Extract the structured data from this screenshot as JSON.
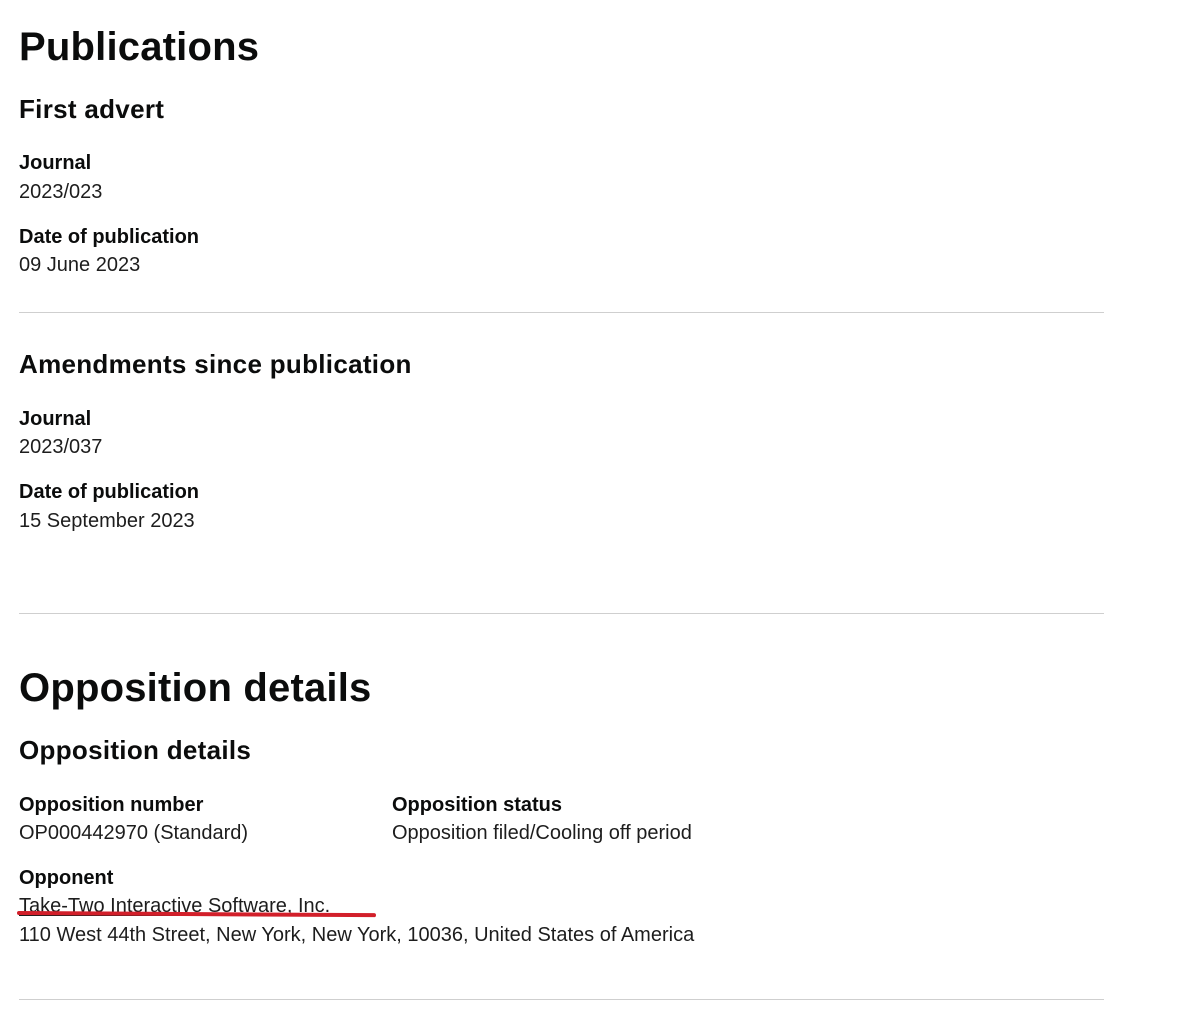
{
  "publications": {
    "heading": "Publications",
    "first_advert": {
      "heading": "First advert",
      "journal_label": "Journal",
      "journal_value": "2023/023",
      "date_label": "Date of publication",
      "date_value": "09 June 2023"
    },
    "amendments": {
      "heading": "Amendments since publication",
      "journal_label": "Journal",
      "journal_value": "2023/037",
      "date_label": "Date of publication",
      "date_value": "15 September 2023"
    }
  },
  "opposition": {
    "heading": "Opposition details",
    "subheading": "Opposition details",
    "number_label": "Opposition number",
    "number_value": "OP000442970 (Standard)",
    "status_label": "Opposition status",
    "status_value": "Opposition filed/Cooling off period",
    "opponent_label": "Opponent",
    "opponent_name": "Take-Two Interactive Software, Inc.",
    "opponent_address": "110 West 44th Street, New York, New York, 10036, United States of America"
  },
  "colors": {
    "text": "#0b0c0c",
    "divider": "#cfcfcf",
    "annotation_underline": "#d21f2a"
  }
}
